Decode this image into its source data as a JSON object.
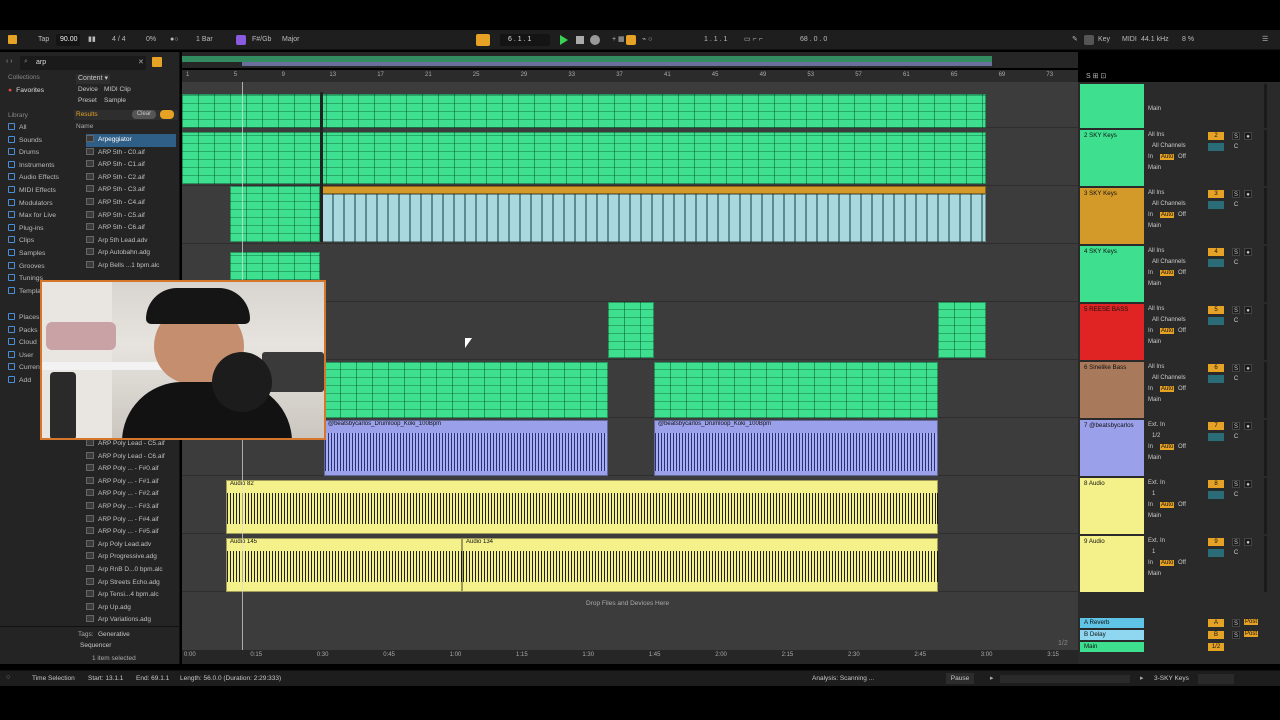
{
  "topbar": {
    "tap": "Tap",
    "tempo": "90.00",
    "signature": "4 / 4",
    "cpu": "0%",
    "quantize": "1 Bar",
    "scale_root": "F#/Gb",
    "scale_mode": "Major",
    "position": "6 . 1 . 1",
    "loop_start": "1 . 1 . 1",
    "loop_length": "68 . 0 . 0",
    "key": "Key",
    "midi": "MIDI",
    "sample_rate": "44.1 kHz",
    "cpu_load": "8 %"
  },
  "browser": {
    "search_value": "arp",
    "collections_header": "Collections",
    "favorites": "Favorites",
    "library_header": "Library",
    "library_items": [
      "All",
      "Sounds",
      "Drums",
      "Instruments",
      "Audio Effects",
      "MIDI Effects",
      "Modulators",
      "Max for Live",
      "Plug-ins",
      "Clips",
      "Samples",
      "Grooves",
      "Tunings",
      "Templates"
    ],
    "places_items": [
      "Places",
      "Packs",
      "Cloud",
      "User",
      "Current",
      "Add"
    ],
    "content_filter": "Content",
    "filter_tags": [
      "Device",
      "MIDI Clip",
      "Preset",
      "Sample"
    ],
    "results_label": "Results",
    "clear_label": "Clear",
    "name_header": "Name",
    "results_top": [
      "Arpeggiator",
      "ARP 5th - C0.aif",
      "ARP 5th - C1.aif",
      "ARP 5th - C2.aif",
      "ARP 5th - C3.aif",
      "ARP 5th - C4.aif",
      "ARP 5th - C5.aif",
      "ARP 5th - C6.aif",
      "Arp 5th Lead.adv",
      "Arp Autobahn.adg",
      "Arp Bells ...1 bpm.alc"
    ],
    "results_bottom": [
      "ARP Poly Lead - C5.aif",
      "ARP Poly Lead - C6.aif",
      "ARP Poly ... - F#0.aif",
      "ARP Poly ... - F#1.aif",
      "ARP Poly ... - F#2.aif",
      "ARP Poly ... - F#3.aif",
      "ARP Poly ... - F#4.aif",
      "ARP Poly ... - F#5.aif",
      "Arp Poly Lead.adv",
      "Arp Progressive.adg",
      "Arp RnB D...0 bpm.alc",
      "Arp Streets Echo.adg",
      "Arp Tensi...4 bpm.alc",
      "Arp Up.adg",
      "Arp Variations.adg"
    ],
    "tags_label": "Tags:",
    "tag_value": "Generative",
    "tag_value2": "Sequencer",
    "selected_count": "1 item selected"
  },
  "ruler": {
    "bars": [
      "1",
      "5",
      "9",
      "13",
      "17",
      "21",
      "25",
      "29",
      "33",
      "37",
      "41",
      "45",
      "49",
      "53",
      "57",
      "61",
      "65",
      "69",
      "73"
    ]
  },
  "time_ruler": {
    "times": [
      "0:00",
      "0:15",
      "0:30",
      "0:45",
      "1:00",
      "1:15",
      "1:30",
      "1:45",
      "2:00",
      "2:15",
      "2:30",
      "2:45",
      "3:00",
      "3:15"
    ],
    "page_indicator": "1/2"
  },
  "clips": {
    "drumloop_a": "@beatsbycarlos_Drumloop_Koki_100Bpm",
    "drumloop_b": "@beatsbycarlos_Drumloop_Koki_100Bpm",
    "audio_a": "Audio 82",
    "audio_b": "Audio 145",
    "audio_c": "Audio 134",
    "drop_hint": "Drop Files and Devices Here"
  },
  "tracks": [
    {
      "name": "",
      "color": "#3ee08f",
      "input": "",
      "channel": "",
      "num": ""
    },
    {
      "name": "2 SKY Keys",
      "color": "#3ee08f",
      "input": "All Ins",
      "channel": "All Channels",
      "num": "2"
    },
    {
      "name": "3 SKY Keys",
      "color": "#d39a2a",
      "input": "All Ins",
      "channel": "All Channels",
      "num": "3"
    },
    {
      "name": "4 SKY Keys",
      "color": "#3ee08f",
      "input": "All Ins",
      "channel": "All Channels",
      "num": "4"
    },
    {
      "name": "5 REESE BASS",
      "color": "#e02424",
      "input": "All Ins",
      "channel": "All Channels",
      "num": "5"
    },
    {
      "name": "6 Sinelike Bass",
      "color": "#a8795a",
      "input": "All Ins",
      "channel": "All Channels",
      "num": "6"
    },
    {
      "name": "7 @beatsbycarlos",
      "color": "#9aa0ea",
      "input": "Ext. In",
      "channel": "1/2",
      "num": "7"
    },
    {
      "name": "8 Audio",
      "color": "#f4f08a",
      "input": "Ext. In",
      "channel": "1",
      "num": "8"
    },
    {
      "name": "9 Audio",
      "color": "#f4f08a",
      "input": "Ext. In",
      "channel": "1",
      "num": "9"
    }
  ],
  "returns": [
    {
      "name": "A Reverb",
      "color": "#5fc4e6",
      "num": "A"
    },
    {
      "name": "B Delay",
      "color": "#8fd6f0",
      "num": "B"
    },
    {
      "name": "Main",
      "color": "#3ee08f",
      "num": "1/2"
    }
  ],
  "mixer_labels": {
    "in": "In",
    "auto": "Auto",
    "off": "Off",
    "main": "Main",
    "s": "S",
    "c": "C",
    "post": "Post"
  },
  "status": {
    "time_selection": "Time Selection",
    "start": "Start: 13.1.1",
    "end": "End: 69.1.1",
    "length": "Length: 56.0.0 (Duration: 2:29:333)",
    "analysis": "Analysis: Scanning ...",
    "pause": "Pause",
    "track": "3-SKY Keys"
  }
}
